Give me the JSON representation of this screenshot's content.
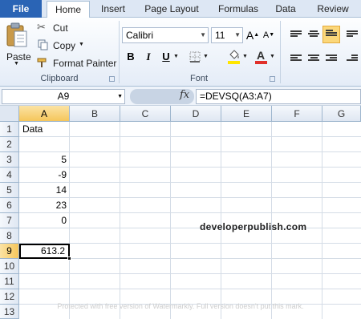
{
  "tabs": {
    "file": "File",
    "home": "Home",
    "insert": "Insert",
    "page_layout": "Page Layout",
    "formulas": "Formulas",
    "data": "Data",
    "review": "Review"
  },
  "ribbon": {
    "clipboard": {
      "paste": "Paste",
      "cut": "Cut",
      "copy": "Copy",
      "format_painter": "Format Painter",
      "label": "Clipboard"
    },
    "font": {
      "name": "Calibri",
      "size": "11",
      "grow": "A",
      "shrink": "A",
      "bold": "B",
      "italic": "I",
      "underline": "U",
      "font_color_letter": "A",
      "label": "Font"
    }
  },
  "formula_bar": {
    "name_box": "A9",
    "fx": "fx",
    "formula": "=DEVSQ(A3:A7)"
  },
  "columns": [
    "A",
    "B",
    "C",
    "D",
    "E",
    "F",
    "G"
  ],
  "rows": [
    "1",
    "2",
    "3",
    "4",
    "5",
    "6",
    "7",
    "8",
    "9",
    "10",
    "11",
    "12",
    "13"
  ],
  "cells": {
    "A1": "Data",
    "A3": "5",
    "A4": "-9",
    "A5": "14",
    "A6": "23",
    "A7": "0",
    "A9": "613.2"
  },
  "watermarks": {
    "site": "developerpublish.com",
    "trial": "Protected with free version of Watermarkly. Full version doesn't put this mark."
  },
  "colors": {
    "file_tab": "#2a64b5",
    "selected_header": "#f5c65b",
    "font_color_bar": "#e0302a",
    "highlight_bar": "#ffe600"
  }
}
